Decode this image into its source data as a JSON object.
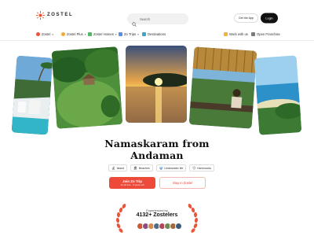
{
  "header": {
    "logo_text": "ZOSTEL",
    "search_placeholder": "Search",
    "get_app_label": "Get the App",
    "login_label": "Login"
  },
  "nav": {
    "left": [
      {
        "label": "Zostel",
        "icon": "zostel-icon",
        "color": "#e8553b"
      },
      {
        "label": "Zostel Plus",
        "icon": "zostel-plus-icon",
        "color": "#f3a93c"
      },
      {
        "label": "Zostel Homes",
        "icon": "homes-icon",
        "color": "#59b36b"
      },
      {
        "label": "Zo Trips",
        "icon": "trips-icon",
        "color": "#5a8ee0"
      },
      {
        "label": "Destinations",
        "icon": "destinations-icon",
        "color": "#3ea4c9"
      }
    ],
    "right": [
      {
        "label": "Work with us",
        "icon": "work-icon",
        "color": "#f1b73a"
      },
      {
        "label": "Open Franchise",
        "icon": "franchise-icon",
        "color": "#7b7b7b"
      }
    ]
  },
  "hero": {
    "title_line1": "Namaskaram from",
    "title_line2": "Andaman",
    "tags": [
      {
        "icon": "island-icon",
        "glyph": "🏝",
        "label": "Island"
      },
      {
        "icon": "beach-icon",
        "glyph": "🏖",
        "label": "Beaches"
      },
      {
        "icon": "underwater-icon",
        "glyph": "🤿",
        "label": "Underwater life"
      },
      {
        "icon": "hammock-icon",
        "glyph": "😊",
        "label": "Hammocks"
      }
    ],
    "primary_button": {
      "label": "Join Zo Trip",
      "sublabel": "12-18 Jan · 5 spots left"
    },
    "secondary_button": {
      "label": "Stay in Zostel"
    }
  },
  "experience": {
    "label": "Experienced by",
    "count": "4132+ Zostelers",
    "avatar_colors": [
      "#c75b39",
      "#8a4f7d",
      "#d18b4a",
      "#4f6b8a",
      "#b2455a",
      "#6b8a4f",
      "#a06a3a",
      "#3a5a7a"
    ]
  },
  "colors": {
    "accent": "#ee4a3a",
    "laurel": "#e8553b"
  }
}
